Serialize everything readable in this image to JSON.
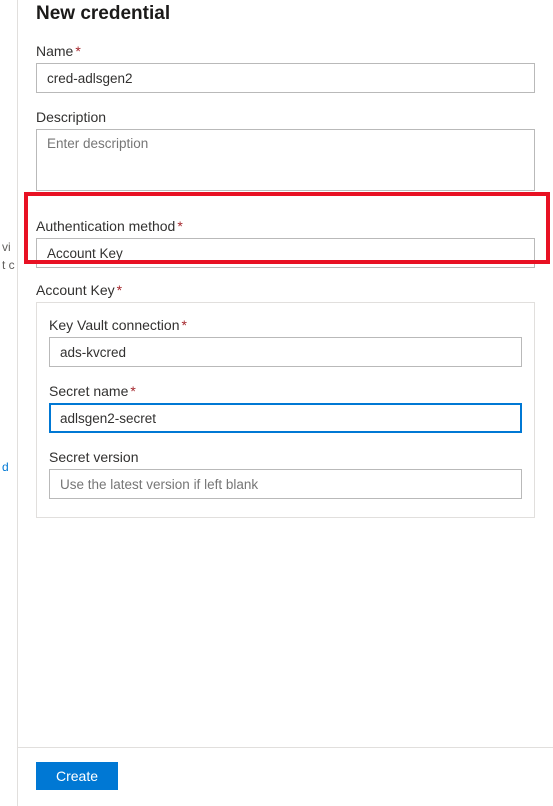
{
  "left_fragments": {
    "f1": "vi",
    "f2": "t c",
    "f3": "d"
  },
  "panel": {
    "title": "New credential",
    "name": {
      "label": "Name",
      "value": "cred-adlsgen2"
    },
    "description": {
      "label": "Description",
      "placeholder": "Enter description",
      "value": ""
    },
    "auth_method": {
      "label": "Authentication method",
      "value": "Account Key"
    },
    "account_key": {
      "section_label": "Account Key",
      "kv_connection": {
        "label": "Key Vault connection",
        "value": "ads-kvcred"
      },
      "secret_name": {
        "label": "Secret name",
        "value": "adlsgen2-secret"
      },
      "secret_version": {
        "label": "Secret version",
        "placeholder": "Use the latest version if left blank",
        "value": ""
      }
    },
    "create_label": "Create"
  }
}
